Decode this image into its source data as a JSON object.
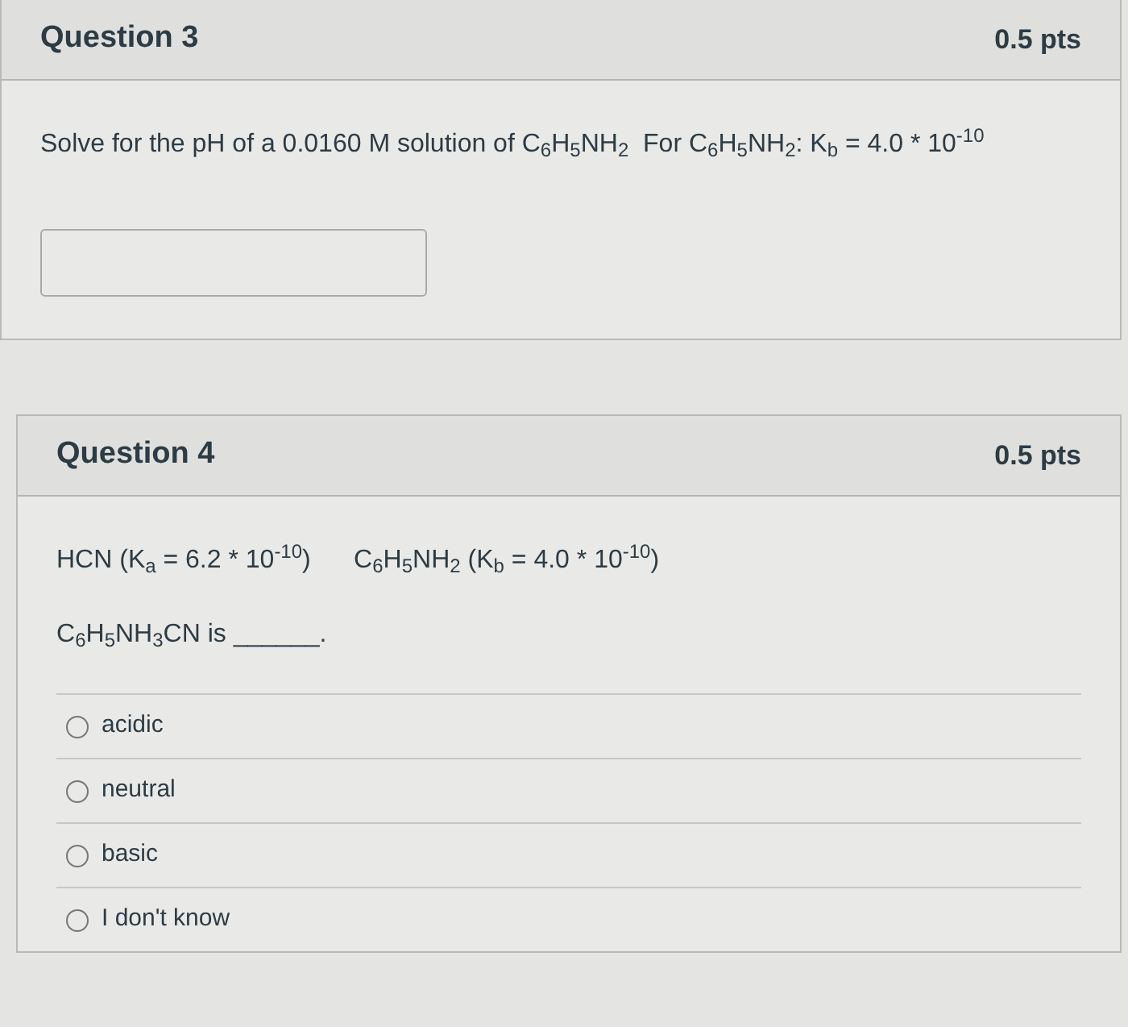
{
  "questions": [
    {
      "title": "Question 3",
      "points": "0.5 pts",
      "kind": "answer",
      "paragraphs": [
        "Solve for the pH of a 0.0160 M solution of C$_{6}$H$_{5}$NH$_{2}$  For C$_{6}$H$_{5}$NH$_{2}$: K$_{b}$ = 4.0 * 10$^{-10}$"
      ]
    },
    {
      "title": "Question 4",
      "points": "0.5 pts",
      "kind": "choice",
      "paragraphs": [
        "HCN (K$_{a}$ = 6.2 * 10$^{-10}$)      C$_{6}$H$_{5}$NH$_{2}$ (K$_{b}$ = 4.0 * 10$^{-10}$)",
        "C$_{6}$H$_{5}$NH$_{3}$CN is ______."
      ],
      "options": [
        {
          "label": "acidic",
          "selected": false
        },
        {
          "label": "neutral",
          "selected": false
        },
        {
          "label": "basic",
          "selected": false
        },
        {
          "label": "I don't know",
          "selected": false
        }
      ]
    }
  ]
}
